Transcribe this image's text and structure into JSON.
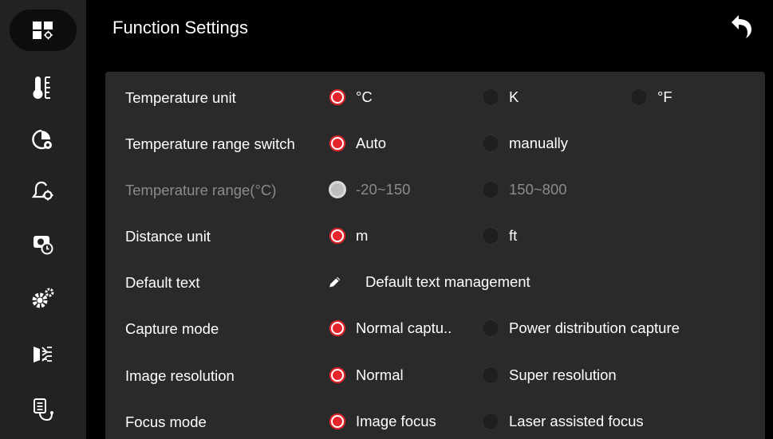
{
  "header": {
    "title": "Function Settings"
  },
  "sidebar": {
    "items": [
      {
        "icon": "function-settings-icon",
        "active": true
      },
      {
        "icon": "thermometer-icon",
        "active": false
      },
      {
        "icon": "palette-settings-icon",
        "active": false
      },
      {
        "icon": "alarm-settings-icon",
        "active": false
      },
      {
        "icon": "camera-timer-icon",
        "active": false
      },
      {
        "icon": "system-settings-icon",
        "active": false
      },
      {
        "icon": "laser-settings-icon",
        "active": false
      },
      {
        "icon": "notes-icon",
        "active": false
      }
    ]
  },
  "settings": [
    {
      "label": "Temperature unit",
      "disabled": false,
      "options": [
        {
          "text": "°C",
          "selected": true
        },
        {
          "text": "K",
          "selected": false
        },
        {
          "text": "°F",
          "selected": false
        }
      ]
    },
    {
      "label": "Temperature range switch",
      "disabled": false,
      "options": [
        {
          "text": "Auto",
          "selected": true
        },
        {
          "text": "manually",
          "selected": false
        }
      ]
    },
    {
      "label": "Temperature range(°C)",
      "disabled": true,
      "options": [
        {
          "text": "-20~150",
          "selected": true
        },
        {
          "text": "150~800",
          "selected": false
        }
      ]
    },
    {
      "label": "Distance unit",
      "disabled": false,
      "options": [
        {
          "text": "m",
          "selected": true
        },
        {
          "text": "ft",
          "selected": false
        }
      ]
    },
    {
      "label": "Default text",
      "disabled": false,
      "action": "Default text management"
    },
    {
      "label": "Capture mode",
      "disabled": false,
      "options": [
        {
          "text": "Normal captu..",
          "selected": true
        },
        {
          "text": "Power distribution capture",
          "selected": false
        }
      ]
    },
    {
      "label": "Image resolution",
      "disabled": false,
      "options": [
        {
          "text": "Normal",
          "selected": true
        },
        {
          "text": "Super resolution",
          "selected": false
        }
      ]
    },
    {
      "label": "Focus mode",
      "disabled": false,
      "options": [
        {
          "text": "Image focus",
          "selected": true
        },
        {
          "text": "Laser assisted focus",
          "selected": false
        }
      ]
    }
  ],
  "colors": {
    "accent": "#e5242b",
    "panel": "#2a2a2a",
    "sidebar": "#222222"
  }
}
